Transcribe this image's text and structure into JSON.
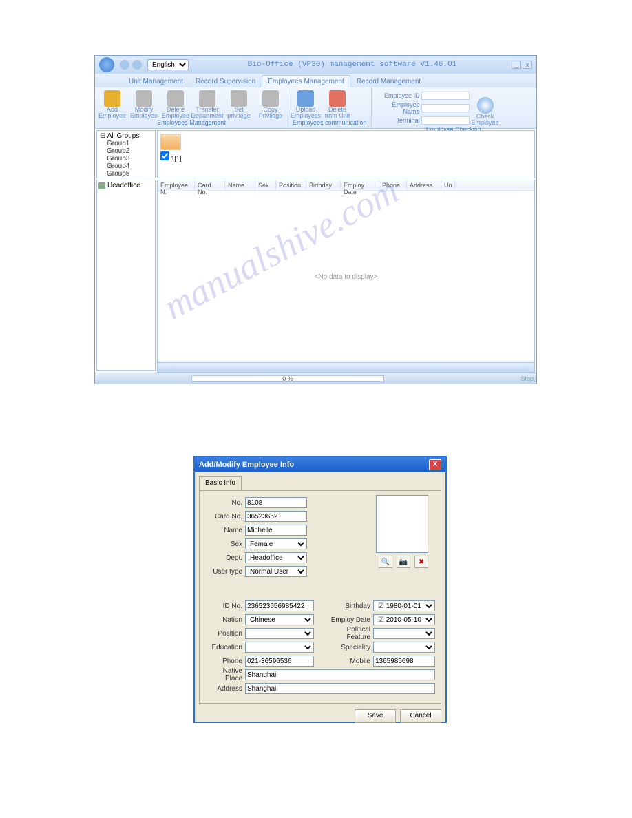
{
  "app": {
    "title": "Bio-Office (VP30) management software V1.46.01",
    "language": "English"
  },
  "tabs": [
    "Unit Management",
    "Record Supervision",
    "Employees Management",
    "Record Management"
  ],
  "activeTab": 2,
  "ribbon": {
    "groups": [
      {
        "caption": "Employees Management",
        "buttons": [
          {
            "label1": "Add",
            "label2": "Employee",
            "color": "#e8b030"
          },
          {
            "label1": "Modify",
            "label2": "Employee",
            "color": "#b8b8b8"
          },
          {
            "label1": "Delete",
            "label2": "Employee",
            "color": "#b8b8b8"
          },
          {
            "label1": "Transfer",
            "label2": "Department",
            "color": "#b8b8b8"
          },
          {
            "label1": "Set",
            "label2": "privilege",
            "color": "#b8b8b8"
          },
          {
            "label1": "Copy",
            "label2": "Privilege",
            "color": "#b8b8b8"
          }
        ]
      },
      {
        "caption": "Employees communication",
        "buttons": [
          {
            "label1": "Upload",
            "label2": "Employees",
            "color": "#6aa0e0"
          },
          {
            "label1": "Delete",
            "label2": "from Unit",
            "color": "#e07060"
          }
        ]
      },
      {
        "caption": "Employee Checking",
        "fields": [
          {
            "label": "Employee ID"
          },
          {
            "label": "Employee Name"
          },
          {
            "label": "Terminal"
          }
        ],
        "checkBtn": {
          "label1": "Check",
          "label2": "Employee"
        }
      }
    ]
  },
  "tree": {
    "root": "All Groups",
    "items": [
      "Group1",
      "Group2",
      "Group3",
      "Group4",
      "Group5"
    ]
  },
  "dept": "Headoffice",
  "thumb": {
    "label": "1[1]"
  },
  "gridCols": [
    "Employee N.",
    "Card No.",
    "Name",
    "Sex",
    "Position",
    "Birthday",
    "Employ Date",
    "Phone",
    "Address",
    "Un"
  ],
  "gridEmpty": "<No data to display>",
  "progress": "0 %",
  "statusStop": "Stop",
  "dialog": {
    "title": "Add/Modify Employee Info",
    "tab": "Basic Info",
    "fields": {
      "no_label": "No.",
      "no": "8108",
      "card_label": "Card No.",
      "card": "36523652",
      "name_label": "Name",
      "name": "Michelle",
      "sex_label": "Sex",
      "sex": "Female",
      "dept_label": "Dept.",
      "dept": "Headoffice",
      "usertype_label": "User type",
      "usertype": "Normal User",
      "idno_label": "ID No.",
      "idno": "236523656985422",
      "nation_label": "Nation",
      "nation": "Chinese",
      "position_label": "Position",
      "position": "",
      "education_label": "Education",
      "education": "",
      "phone_label": "Phone",
      "phone": "021-36596536",
      "native_label": "Native Place",
      "native": "Shanghai",
      "address_label": "Address",
      "address": "Shanghai",
      "birthday_label": "Birthday",
      "birthday": "1980-01-01",
      "employ_label": "Employ Date",
      "employ": "2010-05-10",
      "political_label": "Political Feature",
      "political": "",
      "speciality_label": "Speciality",
      "speciality": "",
      "mobile_label": "Mobile",
      "mobile": "1365985698"
    },
    "save": "Save",
    "cancel": "Cancel"
  }
}
